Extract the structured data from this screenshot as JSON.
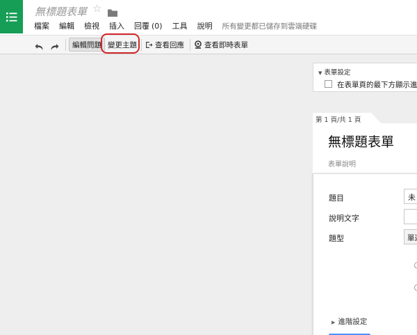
{
  "app": {
    "title": "無標題表單",
    "star_icon": "☆",
    "brand_color": "#169d56"
  },
  "menu": {
    "items": [
      "檔案",
      "編輯",
      "檢視",
      "插入",
      "回覆",
      "工具",
      "說明"
    ],
    "responses_count": "(0)",
    "save_status": "所有變更都已儲存到雲端硬碟"
  },
  "toolbar": {
    "edit_questions": "編輯問題",
    "change_theme": "變更主題",
    "view_responses": "查看回應",
    "view_live_form": "查看即時表單",
    "highlight_color": "#d0262a"
  },
  "form_settings": {
    "title": "表單設定",
    "option_label": "在表單頁的最下方顯示進"
  },
  "page_indicator": "第 1 頁/共 1 頁",
  "form": {
    "title": "無標題表單",
    "description_placeholder": "表單說明"
  },
  "question": {
    "title_label": "題目",
    "title_value": "未",
    "help_label": "說明文字",
    "help_value": "",
    "type_label": "題型",
    "type_value": "單選",
    "advanced_label": "進階設定"
  }
}
